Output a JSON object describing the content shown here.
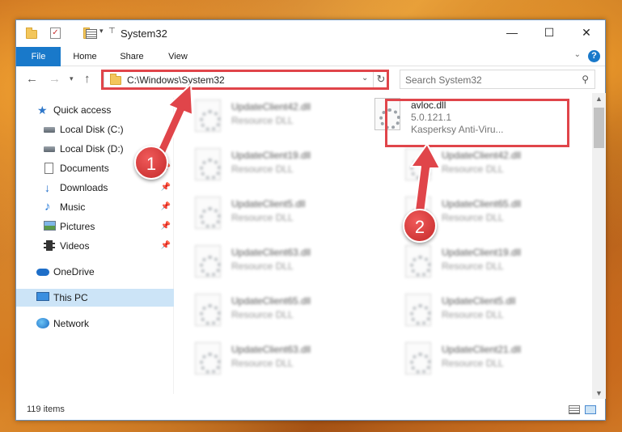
{
  "window": {
    "title": "System32",
    "controls": {
      "minimize": "—",
      "maximize": "☐",
      "close": "✕"
    }
  },
  "ribbon": {
    "tabs": [
      "File",
      "Home",
      "Share",
      "View"
    ],
    "help": "?"
  },
  "nav": {
    "address": "C:\\Windows\\System32",
    "search_placeholder": "Search System32"
  },
  "sidebar": {
    "items": [
      {
        "label": "Quick access",
        "icon": "star-icon",
        "pinned": false
      },
      {
        "label": "Local Disk (C:)",
        "icon": "disk-icon",
        "pinned": false
      },
      {
        "label": "Local Disk (D:)",
        "icon": "disk-icon",
        "pinned": false
      },
      {
        "label": "Documents",
        "icon": "documents-icon",
        "pinned": true
      },
      {
        "label": "Downloads",
        "icon": "download-icon",
        "pinned": true
      },
      {
        "label": "Music",
        "icon": "music-icon",
        "pinned": true
      },
      {
        "label": "Pictures",
        "icon": "pictures-icon",
        "pinned": true
      },
      {
        "label": "Videos",
        "icon": "videos-icon",
        "pinned": true
      },
      {
        "label": "OneDrive",
        "icon": "onedrive-icon",
        "pinned": false
      },
      {
        "label": "This PC",
        "icon": "this-pc-icon",
        "pinned": false,
        "selected": true
      },
      {
        "label": "Network",
        "icon": "network-icon",
        "pinned": false
      }
    ]
  },
  "files": {
    "highlighted": {
      "name": "avloc.dll",
      "version": "5.0.121.1",
      "company": "Kasperksy Anti-Viru..."
    },
    "left_column": [
      {
        "name": "UpdateClient42.dll",
        "type": "Resource DLL"
      },
      {
        "name": "UpdateClient19.dll",
        "type": "Resource DLL"
      },
      {
        "name": "UpdateClient5.dll",
        "type": "Resource DLL"
      },
      {
        "name": "UpdateClient63.dll",
        "type": "Resource DLL"
      },
      {
        "name": "UpdateClient65.dll",
        "type": "Resource DLL"
      },
      {
        "name": "UpdateClient63.dll",
        "type": "Resource DLL"
      }
    ],
    "right_column": [
      {
        "name": "UpdateClient42.dll",
        "type": "Resource DLL"
      },
      {
        "name": "UpdateClient65.dll",
        "type": "Resource DLL"
      },
      {
        "name": "UpdateClient19.dll",
        "type": "Resource DLL"
      },
      {
        "name": "UpdateClient5.dll",
        "type": "Resource DLL"
      },
      {
        "name": "UpdateClient21.dll",
        "type": "Resource DLL"
      }
    ]
  },
  "status": {
    "items": "119 items"
  },
  "annotations": {
    "step1": "1",
    "step2": "2",
    "color": "#e0454a"
  }
}
